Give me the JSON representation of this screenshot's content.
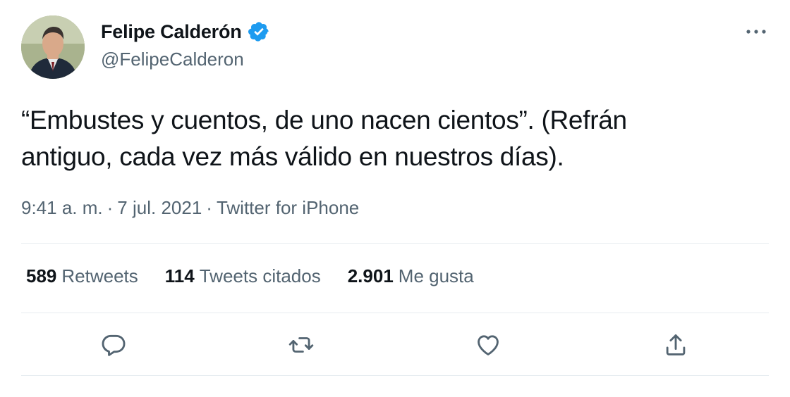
{
  "author": {
    "display_name": "Felipe Calderón",
    "handle": "@FelipeCalderon",
    "verified": true,
    "avatar_icon": "profile-photo"
  },
  "tweet": {
    "text_line1": "“Embustes y cuentos, de uno nacen cientos”. (Refrán",
    "text_line2": "antiguo, cada vez más válido en nuestros días).",
    "time": "9:41 a. m.",
    "date": "7 jul. 2021",
    "source": "Twitter for iPhone",
    "separator": "·"
  },
  "stats": {
    "retweets_count": "589",
    "retweets_label": "Retweets",
    "quotes_count": "114",
    "quotes_label": "Tweets citados",
    "likes_count": "2.901",
    "likes_label": "Me gusta"
  },
  "actions": {
    "reply_icon": "reply-icon",
    "retweet_icon": "retweet-icon",
    "like_icon": "heart-icon",
    "share_icon": "share-icon",
    "more_icon": "more-icon"
  },
  "colors": {
    "text": "#0f1419",
    "secondary": "#536471",
    "verified_blue": "#1d9bf0",
    "divider": "#e6ecf0"
  }
}
